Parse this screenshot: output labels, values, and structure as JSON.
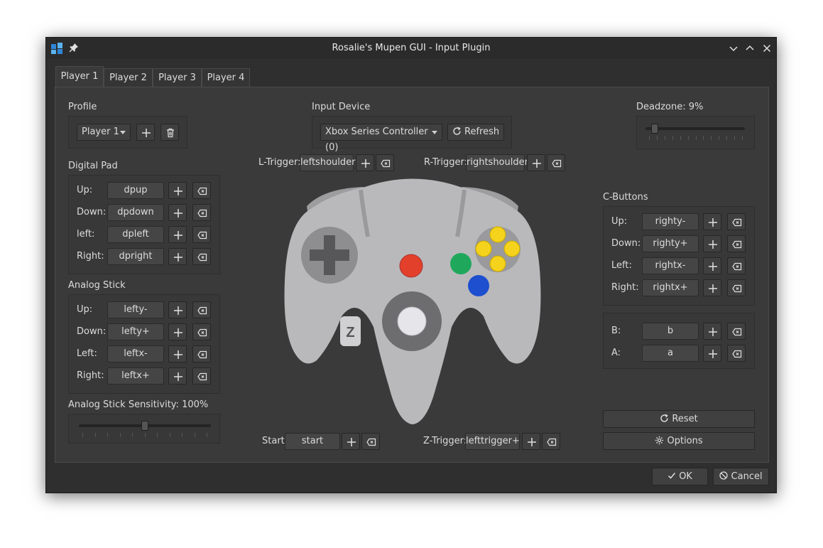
{
  "window": {
    "title": "Rosalie's Mupen GUI - Input Plugin"
  },
  "tabs": [
    {
      "label": "Player 1"
    },
    {
      "label": "Player 2"
    },
    {
      "label": "Player 3"
    },
    {
      "label": "Player 4"
    }
  ],
  "profile": {
    "label": "Profile",
    "selected": "Player 1"
  },
  "input_device": {
    "label": "Input Device",
    "selected": "Xbox Series Controller (0)",
    "refresh_label": "Refresh"
  },
  "deadzone": {
    "label": "Deadzone: 9%",
    "value_percent": 9
  },
  "digital_pad": {
    "title": "Digital Pad",
    "rows": [
      {
        "label": "Up:",
        "value": "dpup"
      },
      {
        "label": "Down:",
        "value": "dpdown"
      },
      {
        "label": "left:",
        "value": "dpleft"
      },
      {
        "label": "Right:",
        "value": "dpright"
      }
    ]
  },
  "analog_stick": {
    "title": "Analog Stick",
    "rows": [
      {
        "label": "Up:",
        "value": "lefty-"
      },
      {
        "label": "Down:",
        "value": "lefty+"
      },
      {
        "label": "Left:",
        "value": "leftx-"
      },
      {
        "label": "Right:",
        "value": "leftx+"
      }
    ]
  },
  "sensitivity": {
    "label": "Analog Stick Sensitivity: 100%",
    "value_percent": 100
  },
  "triggers": {
    "l_label": "L-Trigger:",
    "l_value": "leftshoulder",
    "r_label": "R-Trigger:",
    "r_value": "rightshoulder",
    "start_label": "Start:",
    "start_value": "start",
    "z_label": "Z-Trigger:",
    "z_value": "lefttrigger+"
  },
  "controller": {
    "z_glyph": "Z"
  },
  "c_buttons": {
    "title": "C-Buttons",
    "rows": [
      {
        "label": "Up:",
        "value": "righty-"
      },
      {
        "label": "Down:",
        "value": "righty+"
      },
      {
        "label": "Left:",
        "value": "rightx-"
      },
      {
        "label": "Right:",
        "value": "rightx+"
      }
    ]
  },
  "ab_buttons": {
    "rows": [
      {
        "label": "B:",
        "value": "b"
      },
      {
        "label": "A:",
        "value": "a"
      }
    ]
  },
  "actions": {
    "reset_label": "Reset",
    "options_label": "Options",
    "ok_label": "OK",
    "cancel_label": "Cancel"
  },
  "colors": {
    "red": "#e2402a",
    "green": "#1fa85c",
    "blue": "#1d4fcf",
    "yellow": "#f5d21c",
    "body": "#b9b9bb",
    "window": "#2f2f2f"
  }
}
